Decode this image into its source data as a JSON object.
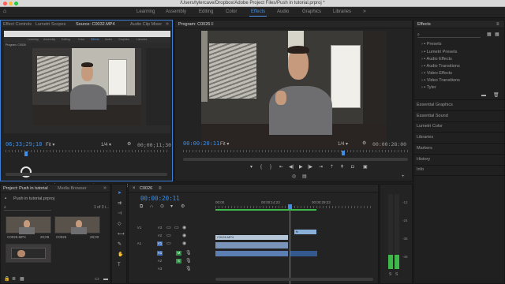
{
  "window": {
    "title": "/Users/tylercave/Dropbox/Adobe Project Files/Push in tutorial.prproj *"
  },
  "workspace": {
    "tabs": [
      {
        "label": "Learning",
        "active": false
      },
      {
        "label": "Assembly",
        "active": false
      },
      {
        "label": "Editing",
        "active": false
      },
      {
        "label": "Color",
        "active": false
      },
      {
        "label": "Effects",
        "active": true
      },
      {
        "label": "Audio",
        "active": false
      },
      {
        "label": "Graphics",
        "active": false
      },
      {
        "label": "Libraries",
        "active": false
      }
    ],
    "more_icon": "double-chevron-icon"
  },
  "source_panel": {
    "tabs": [
      "Effect Controls",
      "Lumetri Scopes",
      "Source: C0032.MP4",
      "Audio Clip Mixer"
    ],
    "active_tab": "Source: C0032.MP4",
    "more_icon": "double-chevron-icon",
    "timecode_in": "06;33;29;18",
    "fit": "Fit",
    "resolution": "1/4",
    "timecode_duration": "00;00;11;30",
    "marker_icon": "marker-icon",
    "inner_tabs": [
      "Learning",
      "Assembly",
      "Editing",
      "Color",
      "Effects",
      "Audio",
      "Graphics",
      "Libraries"
    ],
    "inner_label": "Program: C0026"
  },
  "program_panel": {
    "title": "Program: C0026",
    "menu_icon": "hamburger-icon",
    "timecode_in": "00:00:20:11",
    "fit": "Fit",
    "resolution": "1/4",
    "timecode_duration": "00:00:28:00"
  },
  "effects_panel": {
    "title": "Effects",
    "menu_icon": "hamburger-icon",
    "items": [
      "Presets",
      "Lumetri Presets",
      "Audio Effects",
      "Audio Transitions",
      "Video Effects",
      "Video Transitions",
      "Tyler"
    ],
    "side_items": [
      "Essential Graphics",
      "Essential Sound",
      "Lumetri Color",
      "Libraries",
      "Markers",
      "History",
      "Info"
    ]
  },
  "project_panel": {
    "tabs": [
      "Project: Push in tutorial",
      "Media Browser"
    ],
    "more_icon": "double-chevron-icon",
    "file_name": "Push in tutorial.prproj",
    "count": "1 of 3 i...",
    "clips": [
      {
        "name": "C0026.MP4",
        "duration": "20;09"
      },
      {
        "name": "C0026",
        "duration": "28;00"
      },
      {
        "name": "",
        "duration": ""
      }
    ]
  },
  "timeline": {
    "sequence_tab": "C0026",
    "timecode": "00:00:20:11",
    "ruler_marks": [
      "00:00",
      "00:00:14:23",
      "00:00:29:23"
    ],
    "tracks": [
      {
        "id": "V3",
        "kind": "video"
      },
      {
        "id": "V2",
        "kind": "video"
      },
      {
        "id": "V1",
        "kind": "video"
      },
      {
        "id": "A1",
        "kind": "audio"
      },
      {
        "id": "A2",
        "kind": "audio"
      },
      {
        "id": "A3",
        "kind": "audio"
      }
    ],
    "clips": [
      {
        "name": "C0026.MP4",
        "track": "V1"
      },
      {
        "name": "fx",
        "track": "V2"
      },
      {
        "name": "",
        "track": "A1"
      }
    ]
  },
  "audio_meter": {
    "scale": [
      "-12",
      "-24",
      "-36",
      "-48"
    ],
    "labels": [
      "S",
      "S"
    ]
  },
  "colors": {
    "accent_blue": "#3d8ee8",
    "panel_bg": "#232323",
    "clip_video": "#b6c7d9",
    "clip_audio": "#5c7fb3",
    "meter_green": "#3fb84a"
  }
}
